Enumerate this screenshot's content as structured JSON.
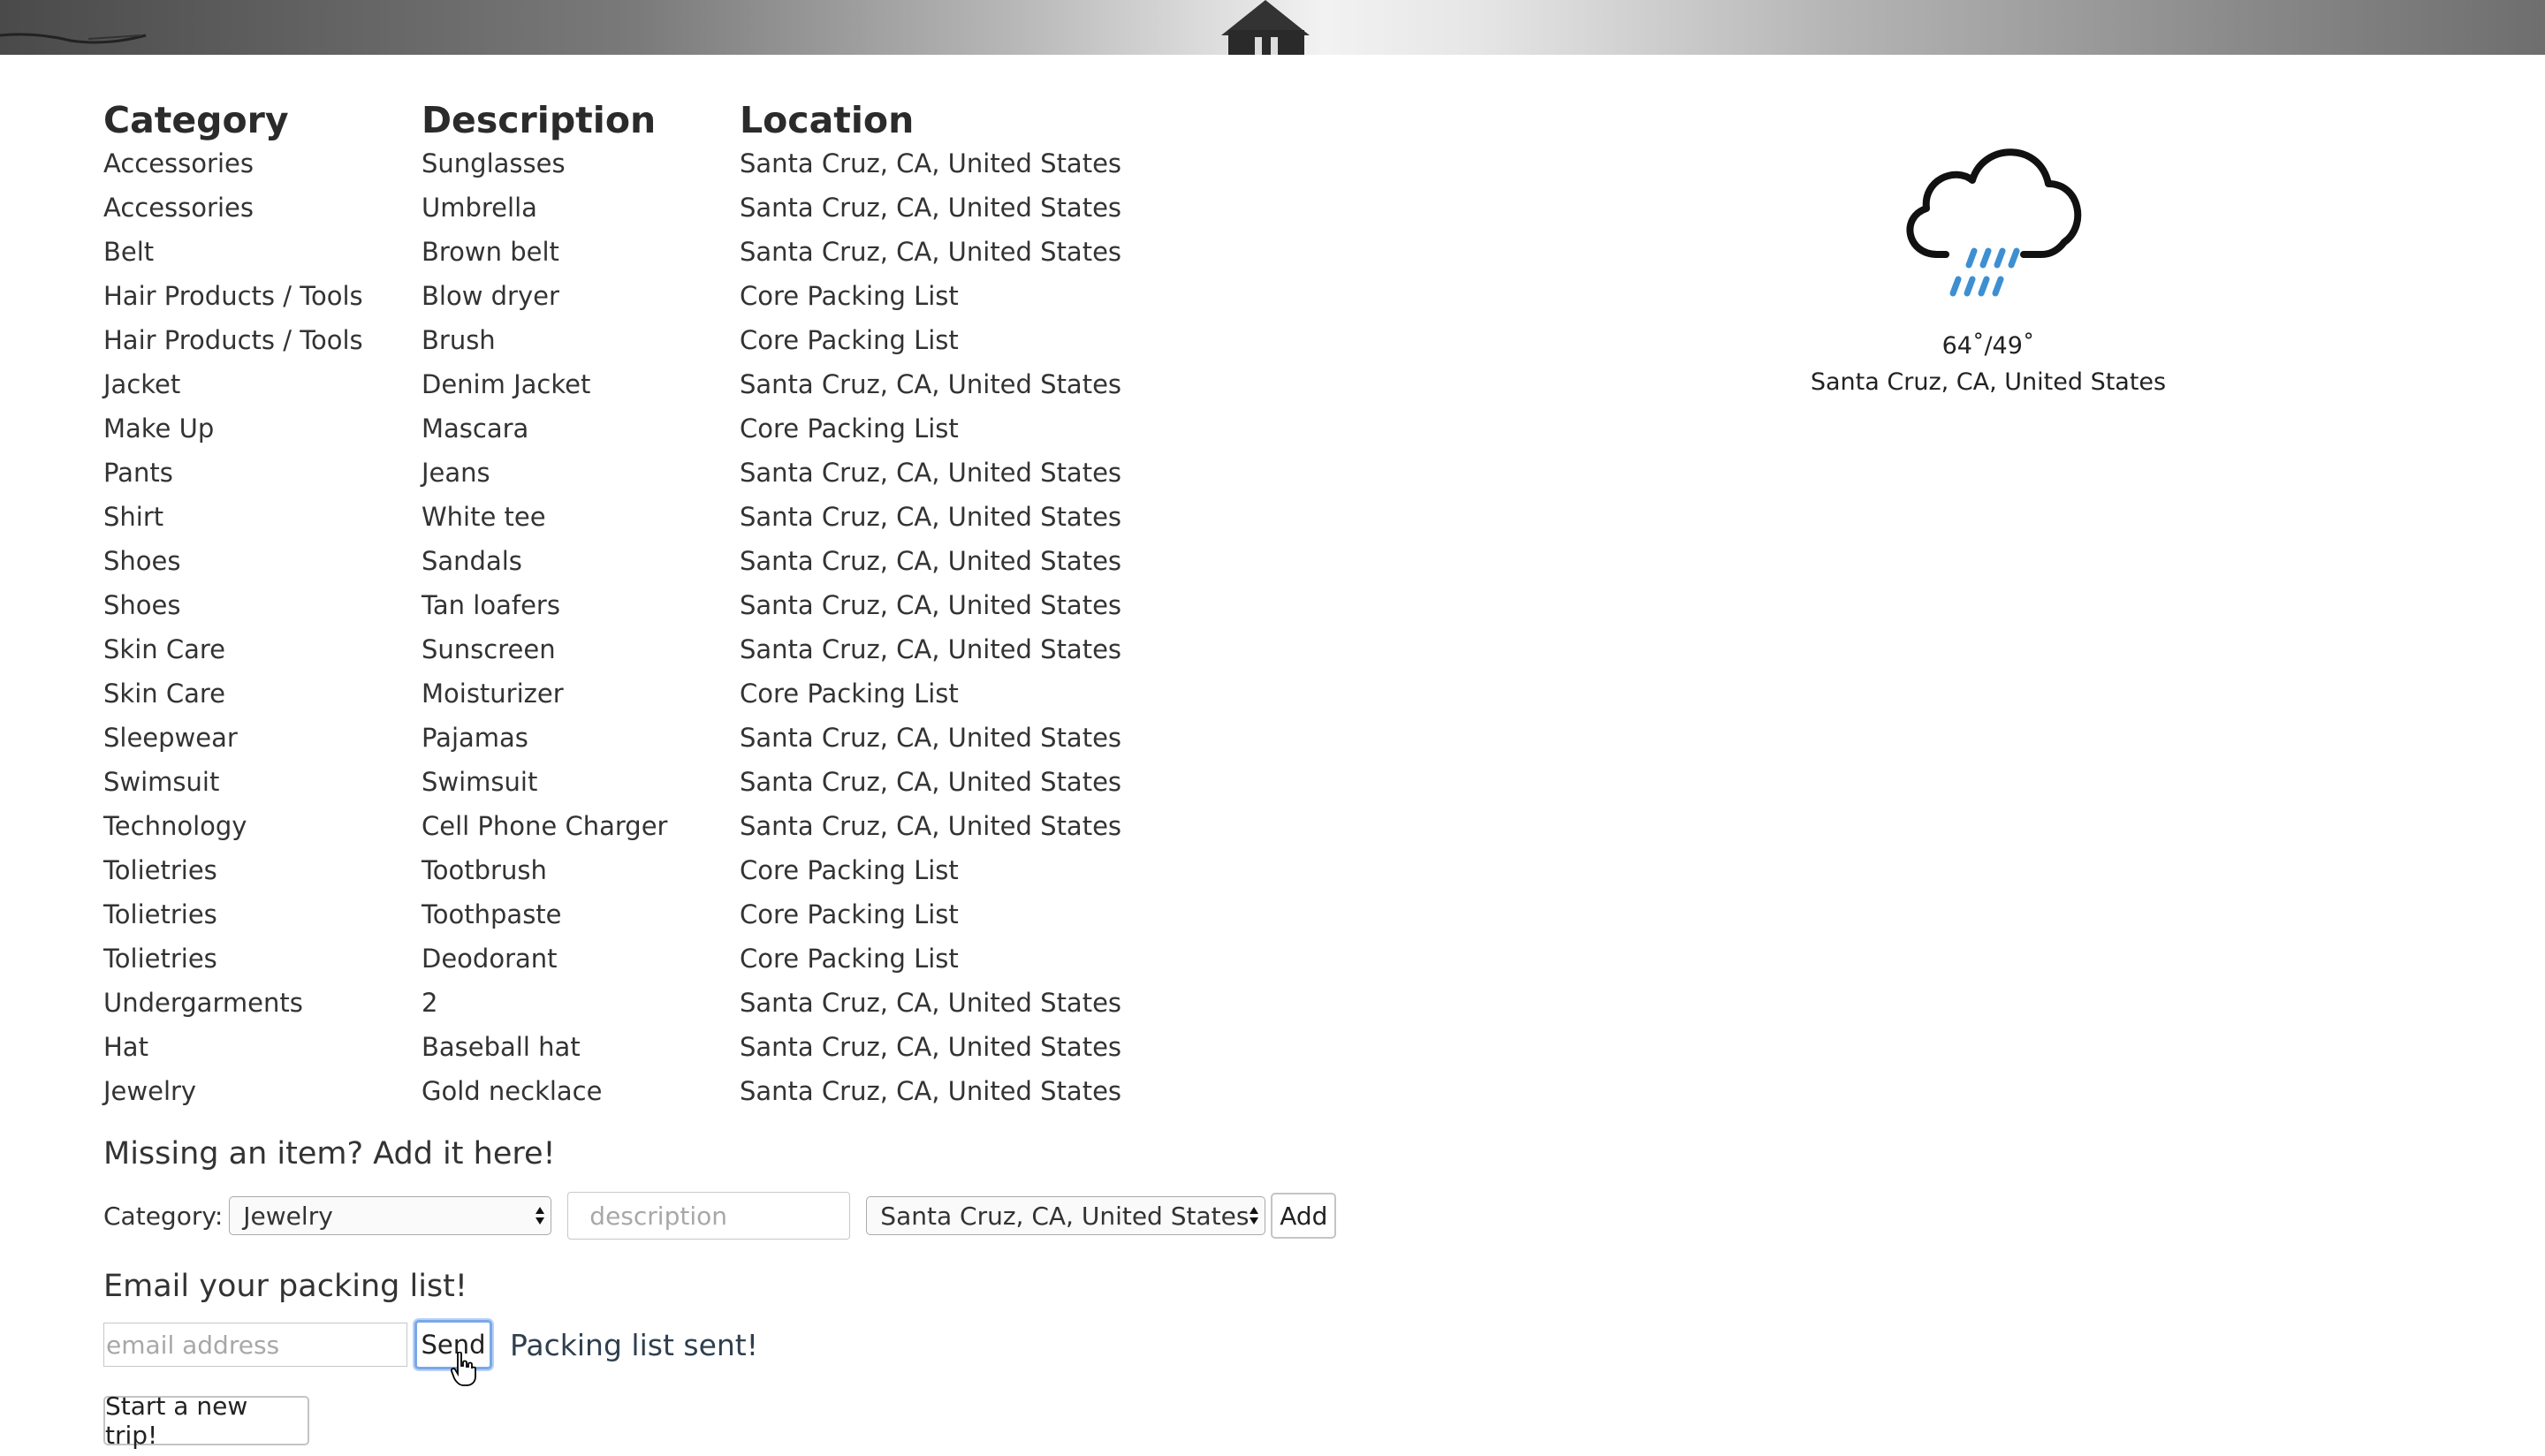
{
  "table": {
    "headers": {
      "category": "Category",
      "description": "Description",
      "location": "Location"
    },
    "rows": [
      {
        "category": "Accessories",
        "description": "Sunglasses",
        "location": "Santa Cruz, CA, United States"
      },
      {
        "category": "Accessories",
        "description": "Umbrella",
        "location": "Santa Cruz, CA, United States"
      },
      {
        "category": "Belt",
        "description": "Brown belt",
        "location": "Santa Cruz, CA, United States"
      },
      {
        "category": "Hair Products / Tools",
        "description": "Blow dryer",
        "location": "Core Packing List"
      },
      {
        "category": "Hair Products / Tools",
        "description": "Brush",
        "location": "Core Packing List"
      },
      {
        "category": "Jacket",
        "description": "Denim Jacket",
        "location": "Santa Cruz, CA, United States"
      },
      {
        "category": "Make Up",
        "description": "Mascara",
        "location": "Core Packing List"
      },
      {
        "category": "Pants",
        "description": "Jeans",
        "location": "Santa Cruz, CA, United States"
      },
      {
        "category": "Shirt",
        "description": "White tee",
        "location": "Santa Cruz, CA, United States"
      },
      {
        "category": "Shoes",
        "description": "Sandals",
        "location": "Santa Cruz, CA, United States"
      },
      {
        "category": "Shoes",
        "description": "Tan loafers",
        "location": "Santa Cruz, CA, United States"
      },
      {
        "category": "Skin Care",
        "description": "Sunscreen",
        "location": "Santa Cruz, CA, United States"
      },
      {
        "category": "Skin Care",
        "description": "Moisturizer",
        "location": "Core Packing List"
      },
      {
        "category": "Sleepwear",
        "description": "Pajamas",
        "location": "Santa Cruz, CA, United States"
      },
      {
        "category": "Swimsuit",
        "description": "Swimsuit",
        "location": "Santa Cruz, CA, United States"
      },
      {
        "category": "Technology",
        "description": "Cell Phone Charger",
        "location": "Santa Cruz, CA, United States"
      },
      {
        "category": "Tolietries",
        "description": "Tootbrush",
        "location": "Core Packing List"
      },
      {
        "category": "Tolietries",
        "description": "Toothpaste",
        "location": "Core Packing List"
      },
      {
        "category": "Tolietries",
        "description": "Deodorant",
        "location": "Core Packing List"
      },
      {
        "category": "Undergarments",
        "description": "2",
        "location": "Santa Cruz, CA, United States"
      },
      {
        "category": "Hat",
        "description": "Baseball hat",
        "location": "Santa Cruz, CA, United States"
      },
      {
        "category": "Jewelry",
        "description": "Gold necklace",
        "location": "Santa Cruz, CA, United States"
      }
    ]
  },
  "weather": {
    "icon": "rain-cloud-icon",
    "temps": "64˚/49˚",
    "location": "Santa Cruz, CA, United States",
    "rain_color": "#3d8fd1"
  },
  "add_form": {
    "heading": "Missing an item? Add it here!",
    "category_label": "Category:",
    "category_value": "Jewelry",
    "description_placeholder": "description",
    "location_value": "Santa Cruz, CA, United States",
    "add_label": "Add"
  },
  "email_form": {
    "heading": "Email your packing list!",
    "email_placeholder": "email address",
    "send_label": "Send",
    "status": "Packing list sent!"
  },
  "new_trip_label": "Start a new trip!"
}
